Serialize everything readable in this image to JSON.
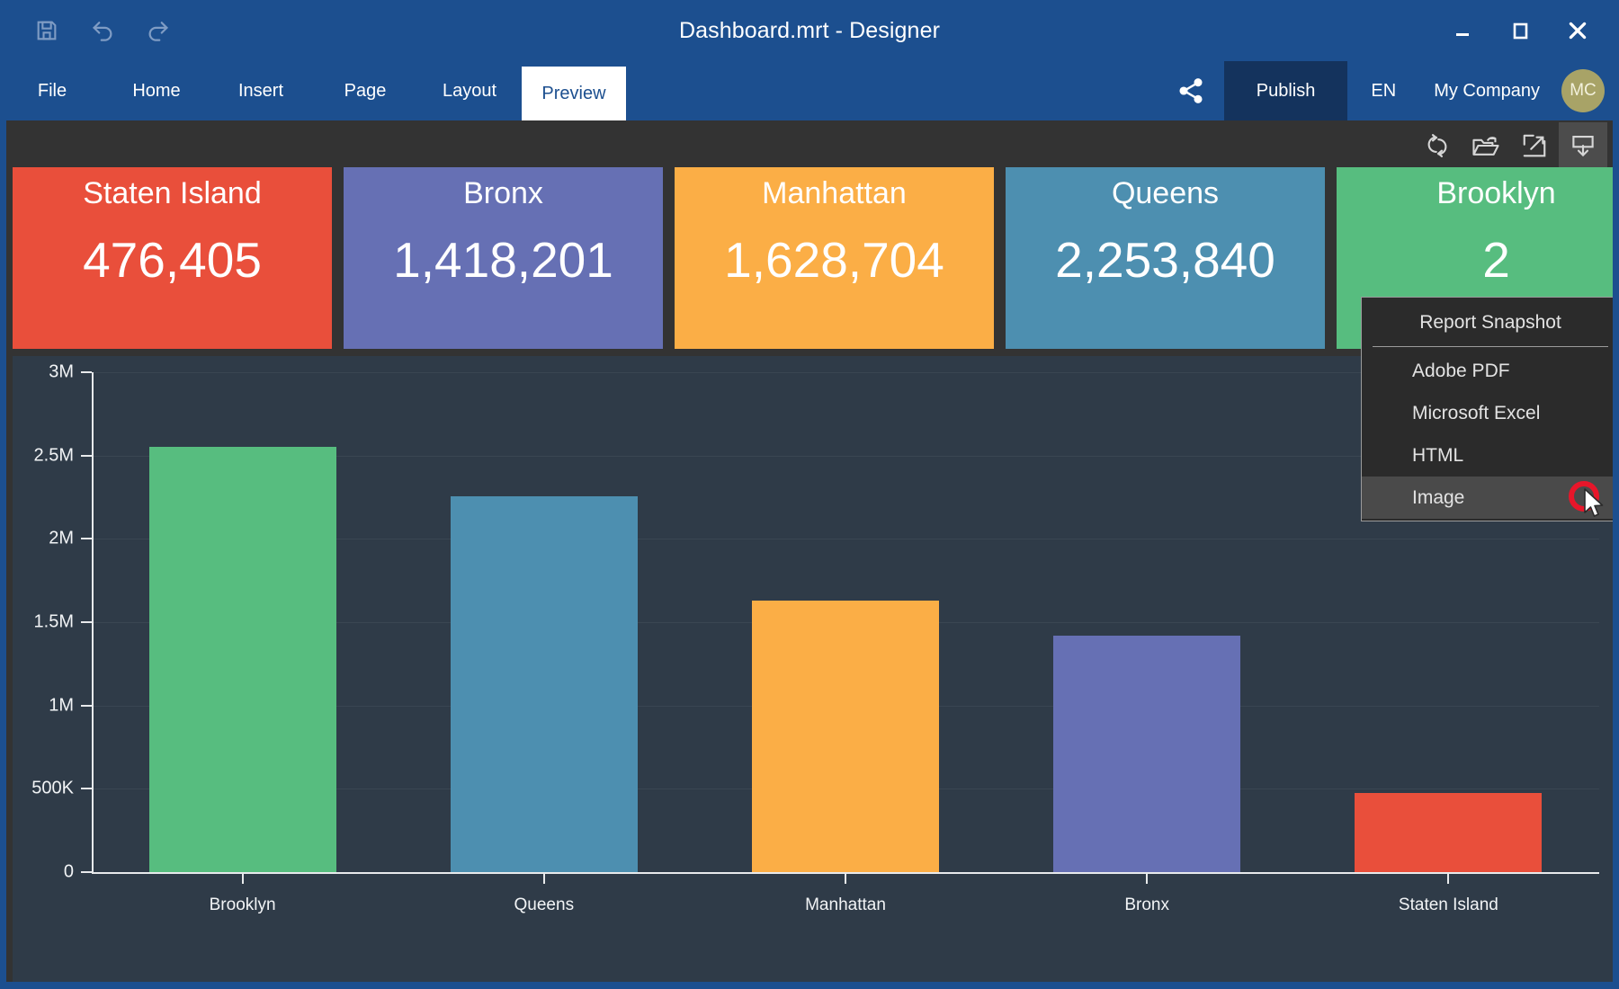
{
  "window": {
    "title": "Dashboard.mrt - Designer",
    "minimize_icon": "minimize-icon",
    "maximize_icon": "maximize-icon",
    "close_icon": "close-icon"
  },
  "quick_access": [
    {
      "name": "save-icon",
      "label": "Save"
    },
    {
      "name": "undo-icon",
      "label": "Undo"
    },
    {
      "name": "redo-icon",
      "label": "Redo"
    }
  ],
  "ribbon": {
    "tabs": [
      {
        "label": "File",
        "active": false
      },
      {
        "label": "Home",
        "active": false
      },
      {
        "label": "Insert",
        "active": false
      },
      {
        "label": "Page",
        "active": false
      },
      {
        "label": "Layout",
        "active": false
      },
      {
        "label": "Preview",
        "active": true
      }
    ],
    "share_icon": "share-icon",
    "publish_label": "Publish",
    "language": "EN",
    "company": "My Company",
    "avatar_initials": "MC",
    "accent_color": "#1c4f8f",
    "publish_bg": "#14335d",
    "avatar_color": "#a8a367"
  },
  "preview_toolbar": [
    {
      "name": "refresh-icon",
      "active": false
    },
    {
      "name": "open-folder-icon",
      "active": false
    },
    {
      "name": "fullscreen-icon",
      "active": false
    },
    {
      "name": "export-icon",
      "active": true
    }
  ],
  "export_menu": {
    "items": [
      {
        "label": "Report Snapshot",
        "highlight": false,
        "separator_after": true
      },
      {
        "label": "Adobe PDF",
        "highlight": false,
        "separator_after": false
      },
      {
        "label": "Microsoft Excel",
        "highlight": false,
        "separator_after": false
      },
      {
        "label": "HTML",
        "highlight": false,
        "separator_after": false
      },
      {
        "label": "Image",
        "highlight": true,
        "separator_after": false
      }
    ],
    "cursor_icon": "mouse-cursor-icon",
    "highlight_ring_color": "#e8162a"
  },
  "kpi_cards": [
    {
      "title": "Staten Island",
      "value": "476,405",
      "color": "#e94f3b"
    },
    {
      "title": "Bronx",
      "value": "1,418,201",
      "color": "#6670b4"
    },
    {
      "title": "Manhattan",
      "value": "1,628,704",
      "color": "#fbae46"
    },
    {
      "title": "Queens",
      "value": "2,253,840",
      "color": "#4d8fb0"
    },
    {
      "title": "Brooklyn",
      "value": "2",
      "color": "#57bd7f"
    }
  ],
  "chart_data": {
    "type": "bar",
    "title": "",
    "xlabel": "",
    "ylabel": "",
    "categories": [
      "Brooklyn",
      "Queens",
      "Manhattan",
      "Bronx",
      "Staten Island"
    ],
    "values": [
      2552911,
      2253840,
      1628704,
      1418201,
      476405
    ],
    "colors": [
      "#57bd7f",
      "#4d8fb0",
      "#fbae46",
      "#6670b4",
      "#e94f3b"
    ],
    "ylim": [
      0,
      3000000
    ],
    "ytick_values": [
      0,
      500000,
      1000000,
      1500000,
      2000000,
      2500000,
      3000000
    ],
    "ytick_labels": [
      "0",
      "500K",
      "1M",
      "1.5M",
      "2M",
      "2.5M",
      "3M"
    ],
    "grid": true,
    "legend": "none",
    "background": "#2f3b48"
  }
}
